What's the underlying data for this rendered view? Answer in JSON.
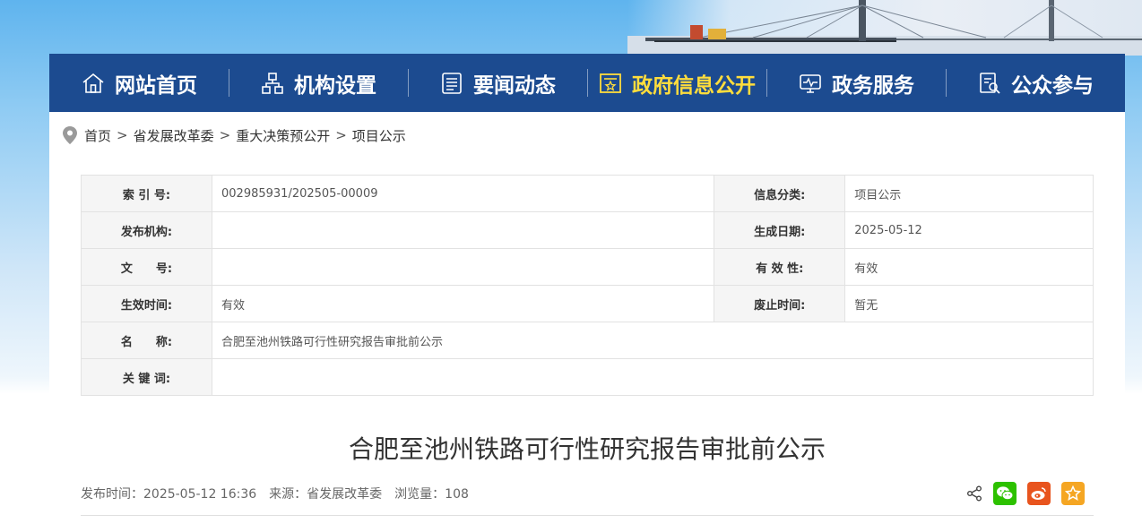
{
  "nav": [
    {
      "label": "网站首页",
      "icon": "home-icon",
      "active": false
    },
    {
      "label": "机构设置",
      "icon": "org-chart-icon",
      "active": false
    },
    {
      "label": "要闻动态",
      "icon": "news-icon",
      "active": false
    },
    {
      "label": "政府信息公开",
      "icon": "info-open-icon",
      "active": true
    },
    {
      "label": "政务服务",
      "icon": "service-monitor-icon",
      "active": false
    },
    {
      "label": "公众参与",
      "icon": "participation-icon",
      "active": false
    }
  ],
  "breadcrumb": [
    "首页",
    "省发展改革委",
    "重大决策预公开",
    "项目公示"
  ],
  "breadcrumb_sep": ">",
  "meta": {
    "index_label": "索 引 号:",
    "index_value": "002985931/202505-00009",
    "category_label": "信息分类:",
    "category_value": "项目公示",
    "publisher_label": "发布机构:",
    "publisher_value": "",
    "created_label": "生成日期:",
    "created_value": "2025-05-12",
    "docno_label": "文　　号:",
    "docno_value": "",
    "validity_label": "有 效 性:",
    "validity_value": "有效",
    "effective_label": "生效时间:",
    "effective_value": "有效",
    "abolish_label": "废止时间:",
    "abolish_value": "暂无",
    "name_label": "名　　称:",
    "name_value": "合肥至池州铁路可行性研究报告审批前公示",
    "keywords_label": "关 键 词:",
    "keywords_value": ""
  },
  "article": {
    "title": "合肥至池州铁路可行性研究报告审批前公示",
    "publish_time": "发布时间：2025-05-12 16:36",
    "source": "来源：省发展改革委",
    "views": "浏览量：108"
  },
  "colors": {
    "nav_bg": "#1c4b90",
    "nav_active": "#ffdd3c",
    "wechat": "#2dc100",
    "weibo": "#e8541e",
    "favorite": "#f5a623"
  }
}
